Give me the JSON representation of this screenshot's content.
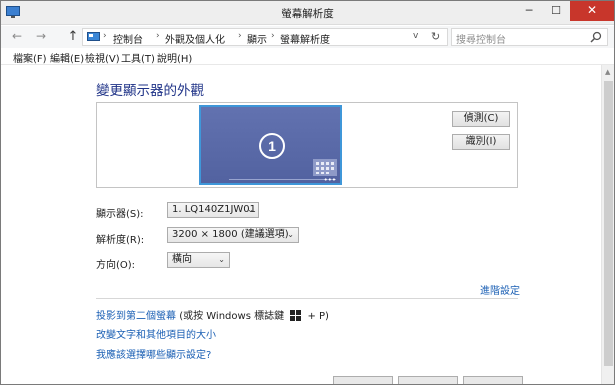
{
  "window": {
    "title": "螢幕解析度",
    "minimize": "─",
    "maximize": "☐",
    "close": "✕"
  },
  "nav": {
    "back": "←",
    "forward": "→",
    "up": "↑",
    "breadcrumbs": [
      "控制台",
      "外觀及個人化",
      "顯示",
      "螢幕解析度"
    ],
    "separator": "›",
    "dropdown": "v",
    "refresh": "↻",
    "search_placeholder": "搜尋控制台"
  },
  "menu": [
    "檔案(F)",
    "編輯(E)",
    "檢視(V)",
    "工具(T)",
    "說明(H)"
  ],
  "main": {
    "title": "變更顯示器的外觀",
    "monitor_number": "1",
    "detect_button": "偵測(C)",
    "identify_button": "識別(I)",
    "fields": [
      {
        "label": "顯示器(S):",
        "value": "1. LQ140Z1JW01"
      },
      {
        "label": "解析度(R):",
        "value": "3200 × 1800 (建議選項)"
      },
      {
        "label": "方向(O):",
        "value": "橫向"
      }
    ],
    "advanced_link": "進階設定",
    "project_link": "投影到第二個螢幕",
    "project_hint_pre": "(或按 Windows 標誌鍵",
    "project_hint_post": "+ P)",
    "text_size_link": "改變文字和其他項目的大小",
    "which_settings_link": "我應該選擇哪些顯示設定?"
  },
  "colors": {
    "title_blue": "#1e3287",
    "link_blue": "#1a5fb4",
    "monitor_fill": "#5a6aa6",
    "monitor_border": "#3f97d9",
    "close_red": "#c8362b"
  }
}
